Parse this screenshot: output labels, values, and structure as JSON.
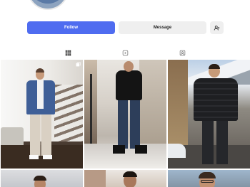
{
  "profile": {
    "follow_label": "Follow",
    "message_label": "Message"
  },
  "tabs": [
    {
      "name": "posts",
      "icon": "grid-icon",
      "active": true
    },
    {
      "name": "reels",
      "icon": "reels-icon",
      "active": false
    },
    {
      "name": "tagged",
      "icon": "tagged-icon",
      "active": false
    }
  ],
  "posts": [
    {
      "icon": "photo",
      "multi": true
    },
    {
      "icon": "photo",
      "multi": false
    },
    {
      "icon": "photo",
      "multi": false
    },
    {
      "icon": "photo",
      "multi": false
    },
    {
      "icon": "photo",
      "multi": false
    },
    {
      "icon": "photo",
      "multi": false
    }
  ],
  "colors": {
    "follow_button": "#4f6cf0",
    "secondary_button": "#efefef",
    "text": "#262626"
  }
}
